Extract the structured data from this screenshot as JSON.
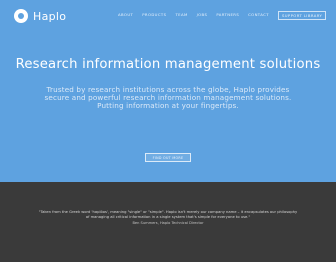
{
  "brand": {
    "name": "Haplo"
  },
  "nav": {
    "items": [
      {
        "label": "About"
      },
      {
        "label": "Products"
      },
      {
        "label": "Team"
      },
      {
        "label": "Jobs"
      },
      {
        "label": "Partners"
      },
      {
        "label": "Contact"
      },
      {
        "label": "Support Library"
      }
    ]
  },
  "hero": {
    "headline": "Research information management solutions",
    "subtext": "Trusted by research institutions across the globe, Haplo provides secure and powerful research information management solutions. Putting information at your fingertips.",
    "cta_label": "FIND OUT MORE"
  },
  "quote": {
    "text": "\"Taken from the Greek word 'haplóos', meaning \"single\" or \"simple\". Haplo isn't merely our company name – it encapsulates our philosophy of managing all critical information in a single system that's simple for everyone to use.\"",
    "attribution_name": "Ben Summers, Haplo Technical Director"
  },
  "colors": {
    "hero_background": "#5ea2e0",
    "quote_background": "#3a3a3a",
    "text_light": "#ffffff"
  },
  "icons": {
    "logo": "haplo-ring-logo-icon"
  }
}
